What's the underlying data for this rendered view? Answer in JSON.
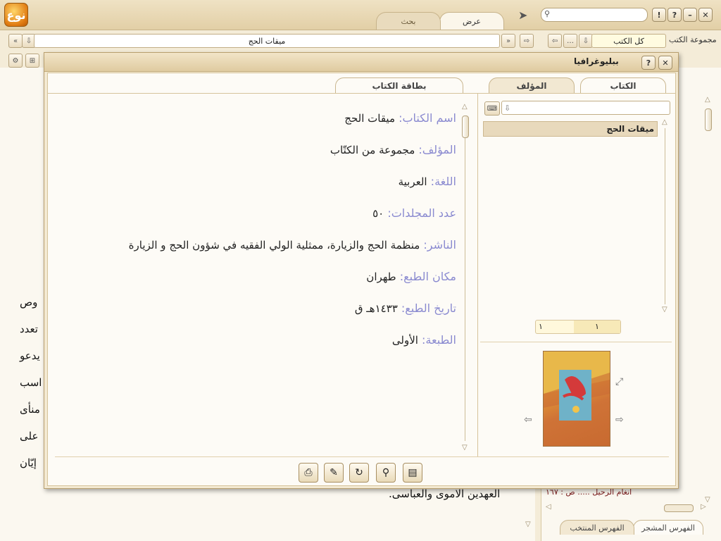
{
  "app": {
    "logo_text": "نوع"
  },
  "tabs": [
    {
      "label": "عرض"
    },
    {
      "label": "بحث"
    }
  ],
  "toolbar": {
    "book_title": "ميقات الحج",
    "books_group_label": "مجموعة الكتب",
    "books_group_value": "كل الكتب"
  },
  "background": {
    "left_lines": [
      "وص",
      "تعدد",
      "يدعو",
      "اسب",
      "منأى",
      "على",
      "إيّان"
    ],
    "bottom_text": "العهدين الاموى والعباسى.",
    "index_entry": "انغام الرحيل ..... ص : ١٦٧",
    "bottom_tabs": [
      "الفهرس المشجر",
      "الفهرس المنتخب"
    ]
  },
  "dialog": {
    "title": "ببليوغرافيا",
    "tabs_left": [
      {
        "label": "الكتاب"
      },
      {
        "label": "المؤلف"
      }
    ],
    "tab_card": "بطاقة الكتاب",
    "list_items": [
      "ميقات الحج"
    ],
    "page_current": "١",
    "page_total": "١",
    "card": [
      {
        "label": "اسم الكتاب",
        "value": "ميقات الحج"
      },
      {
        "label": "المؤلف",
        "value": "مجموعة من الكتّاب"
      },
      {
        "label": "اللغة",
        "value": "العربية"
      },
      {
        "label": "عدد المجلدات",
        "value": "٥٠"
      },
      {
        "label": "الناشر",
        "value": "منظمة الحج والزيارة، ممثلية الولي الفقيه في شؤون الحج و الزيارة"
      },
      {
        "label": "مكان الطبع",
        "value": "طهران"
      },
      {
        "label": "تاريخ الطبع",
        "value": "١٤٣٣هـ ق"
      },
      {
        "label": "الطبعة",
        "value": "الأولى"
      }
    ]
  },
  "colors": {
    "label": "#8a8ad0",
    "accent": "#e07a10",
    "frame": "#c8b48a"
  }
}
